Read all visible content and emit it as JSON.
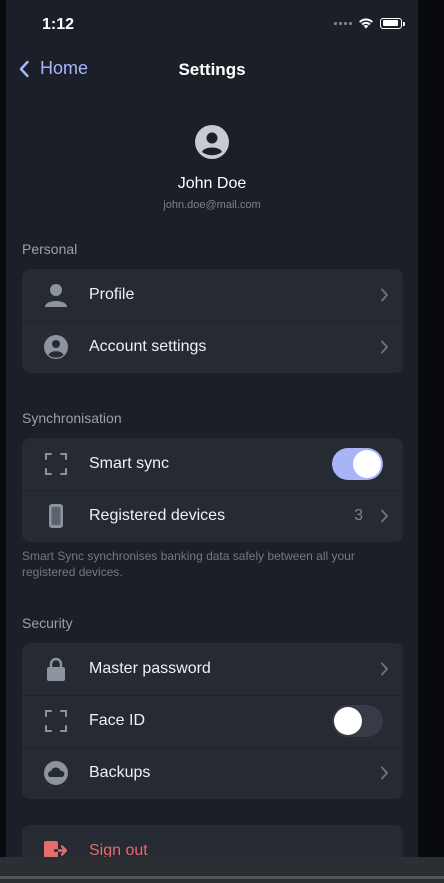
{
  "status_bar": {
    "time": "1:12"
  },
  "nav": {
    "back_label": "Home",
    "title": "Settings"
  },
  "profile": {
    "name": "John Doe",
    "email": "john.doe@mail.com"
  },
  "sections": {
    "personal": {
      "label": "Personal",
      "items": [
        {
          "label": "Profile",
          "icon": "person-icon"
        },
        {
          "label": "Account settings",
          "icon": "account-circle-icon"
        }
      ]
    },
    "sync": {
      "label": "Synchronisation",
      "items": [
        {
          "label": "Smart sync",
          "icon": "scan-frame-icon",
          "toggle": true
        },
        {
          "label": "Registered devices",
          "icon": "phone-icon",
          "value": "3"
        }
      ],
      "help_text": "Smart Sync synchronises banking data safely between all your registered devices."
    },
    "security": {
      "label": "Security",
      "items": [
        {
          "label": "Master password",
          "icon": "lock-icon"
        },
        {
          "label": "Face ID",
          "icon": "face-id-icon",
          "toggle": false
        },
        {
          "label": "Backups",
          "icon": "cloud-icon"
        }
      ]
    }
  },
  "sign_out": {
    "label": "Sign out",
    "icon": "sign-out-icon"
  },
  "colors": {
    "background": "#1b1f27",
    "card": "#252a33",
    "accent": "#a9b6ff",
    "toggle_on": "#a7b4f8",
    "danger": "#e46c69"
  }
}
